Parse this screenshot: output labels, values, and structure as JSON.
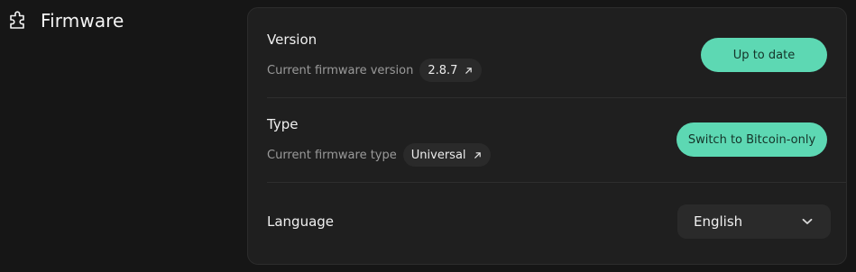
{
  "page": {
    "title": "Firmware",
    "icon": "puzzle-icon"
  },
  "version": {
    "title": "Version",
    "subtitle": "Current firmware version",
    "value": "2.8.7",
    "action_label": "Up to date"
  },
  "type": {
    "title": "Type",
    "subtitle": "Current firmware type",
    "value": "Universal",
    "action_label": "Switch to Bitcoin-only"
  },
  "language": {
    "title": "Language",
    "selected": "English"
  },
  "colors": {
    "accent": "#5dd8b3",
    "background": "#161616",
    "card": "#1f1f1f"
  }
}
